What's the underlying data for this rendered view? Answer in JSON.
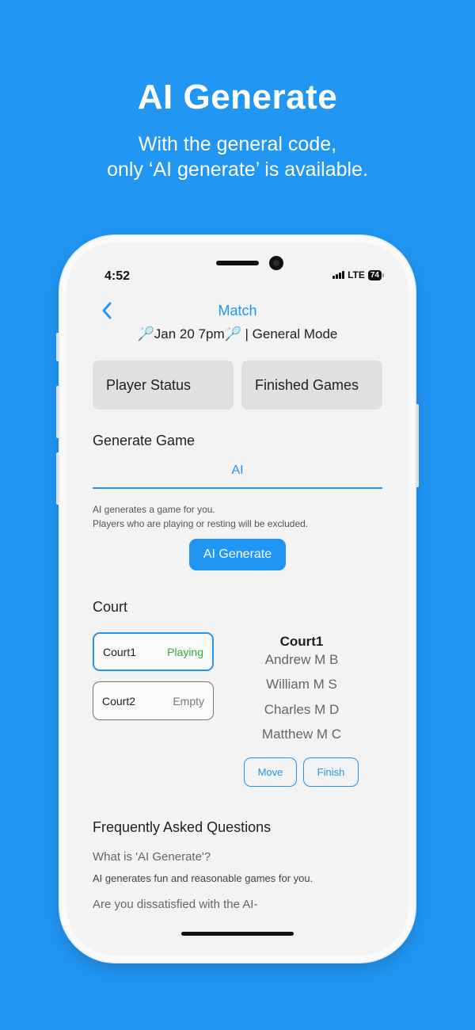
{
  "promo": {
    "title": "AI Generate",
    "subtitle_line1": "With the general code,",
    "subtitle_line2": "only ‘AI generate’ is available."
  },
  "status_bar": {
    "time": "4:52",
    "network": "LTE",
    "battery": "74"
  },
  "nav": {
    "title": "Match",
    "back_icon": "chevron-left-icon"
  },
  "session": {
    "emoji": "🏸",
    "text": "Jan 20 7pm",
    "mode": "| General Mode"
  },
  "tiles": {
    "player_status": "Player Status",
    "finished_games": "Finished Games"
  },
  "generate": {
    "heading": "Generate Game",
    "tab": "AI",
    "help_line1": "AI generates a game for you.",
    "help_line2": "Players who are playing or resting will be excluded.",
    "button": "AI Generate"
  },
  "court": {
    "heading": "Court",
    "list": [
      {
        "name": "Court1",
        "status": "Playing"
      },
      {
        "name": "Court2",
        "status": "Empty"
      }
    ],
    "selected": {
      "name": "Court1",
      "players": [
        "Andrew M B",
        "William M S",
        "Charles M D",
        "Matthew M C"
      ]
    },
    "move_button": "Move",
    "finish_button": "Finish"
  },
  "faq": {
    "heading": "Frequently Asked Questions",
    "q1": "What is 'AI Generate'?",
    "a1": "AI generates fun and reasonable games for you.",
    "q2": "Are you dissatisfied with the AI-"
  },
  "colors": {
    "accent": "#2196F3",
    "playing": "#3aa83a",
    "background": "#2196F3"
  }
}
